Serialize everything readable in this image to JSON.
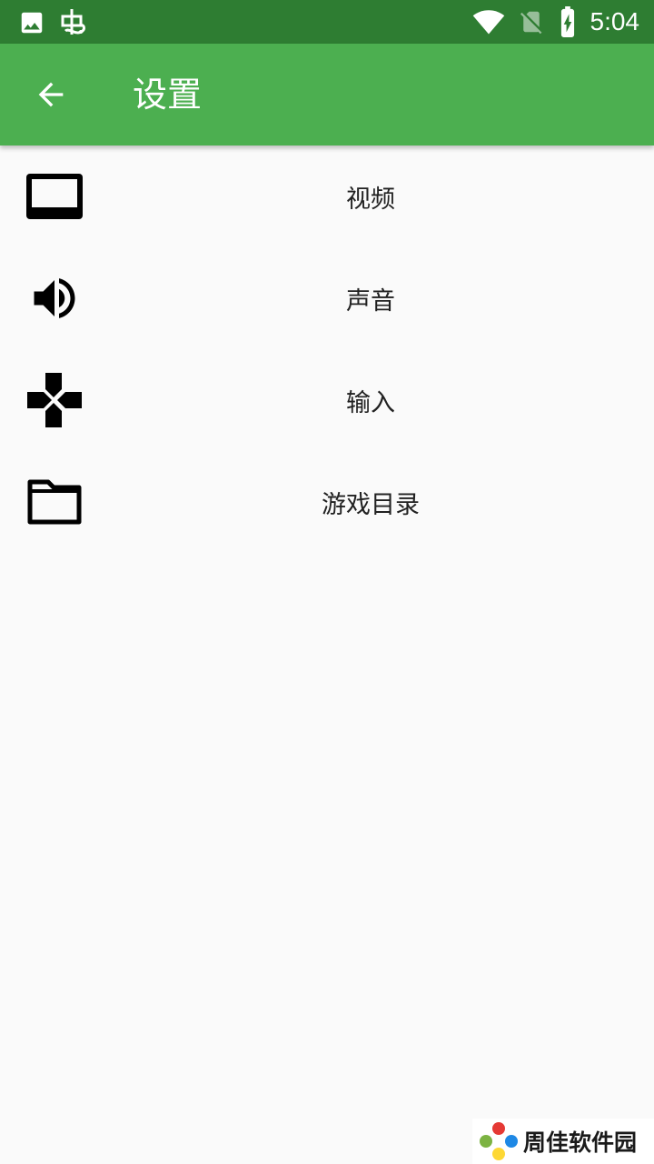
{
  "status_bar": {
    "time": "5:04",
    "left_icons": [
      "image-icon",
      "bug-app-icon"
    ],
    "right_icons": [
      "wifi-icon",
      "no-sim-icon",
      "battery-charging-icon"
    ],
    "background": "#2e7d32"
  },
  "app_bar": {
    "title": "设置",
    "back_icon": "arrow-back-icon",
    "background": "#4caf50"
  },
  "menu": {
    "items": [
      {
        "label": "视频",
        "icon": "video-icon"
      },
      {
        "label": "声音",
        "icon": "volume-icon"
      },
      {
        "label": "输入",
        "icon": "gamepad-icon"
      },
      {
        "label": "游戏目录",
        "icon": "folder-icon"
      }
    ]
  },
  "watermark": {
    "text": "周佳软件园"
  }
}
